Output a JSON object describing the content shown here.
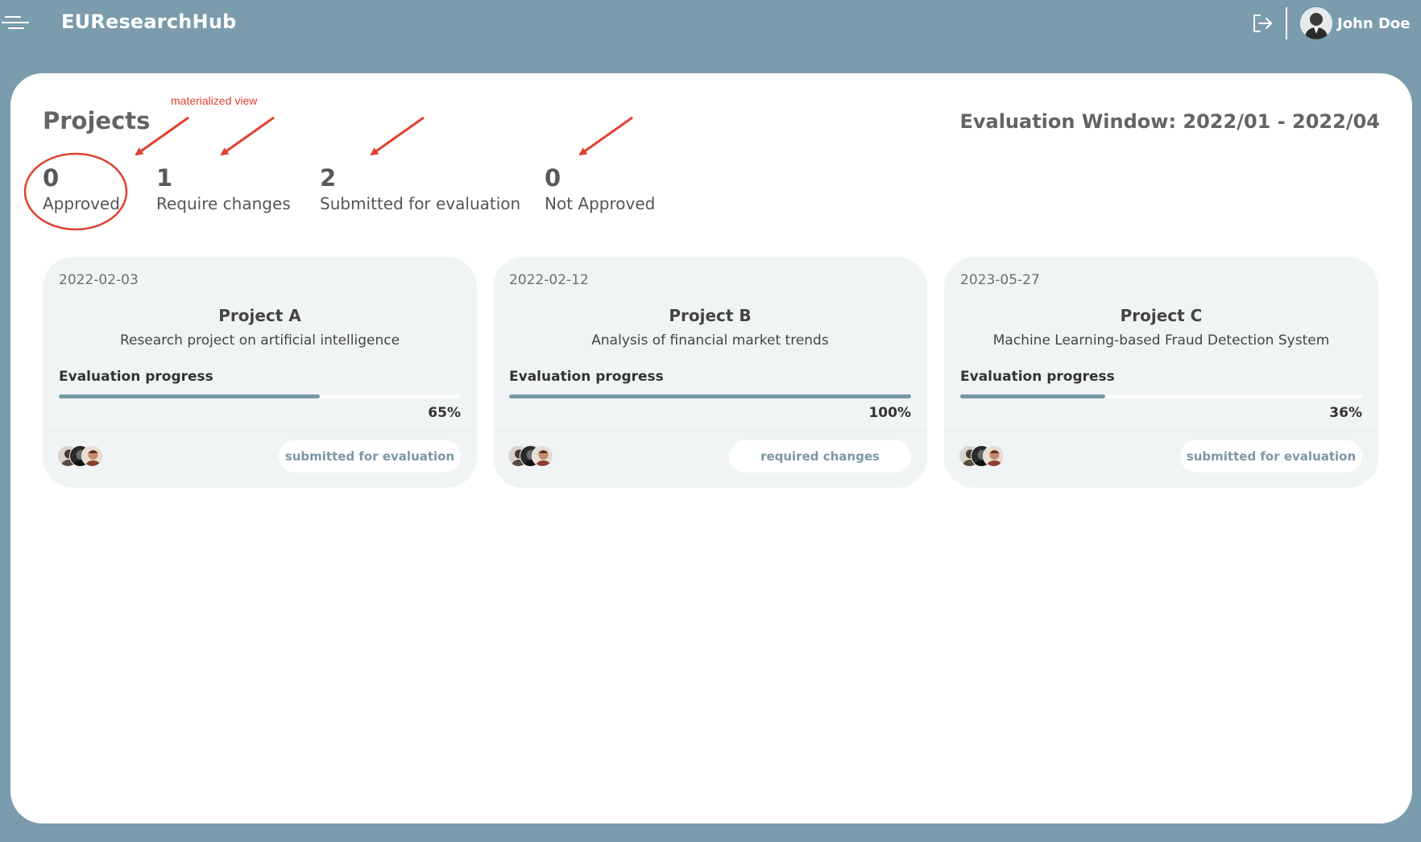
{
  "header": {
    "app_title": "EUResearchHub",
    "menu_icon": "hamburger-menu-icon",
    "logout_icon": "logout-icon",
    "user": {
      "name": "John Doe",
      "avatar_icon": "user-avatar"
    }
  },
  "page": {
    "title": "Projects",
    "evaluation_window": "Evaluation Window: 2022/01 - 2022/04"
  },
  "annotation": {
    "label": "materialized view",
    "color": "#e0402f"
  },
  "stats": [
    {
      "count": "0",
      "label": "Approved"
    },
    {
      "count": "1",
      "label": "Require changes"
    },
    {
      "count": "2",
      "label": "Submitted for evaluation"
    },
    {
      "count": "0",
      "label": "Not Approved"
    }
  ],
  "projects": [
    {
      "date": "2022-02-03",
      "title": "Project A",
      "description": "Research project on artificial intelligence",
      "progress_label": "Evaluation progress",
      "progress": 0.65,
      "progress_text": "65%",
      "status": "submitted for evaluation"
    },
    {
      "date": "2022-02-12",
      "title": "Project B",
      "description": "Analysis of financial market trends",
      "progress_label": "Evaluation progress",
      "progress": 1.0,
      "progress_text": "100%",
      "status": "required changes"
    },
    {
      "date": "2023-05-27",
      "title": "Project C",
      "description": "Machine Learning-based Fraud Detection System",
      "progress_label": "Evaluation progress",
      "progress": 0.36,
      "progress_text": "36%",
      "status": "submitted for evaluation"
    }
  ],
  "colors": {
    "background": "#7b9cac",
    "accent": "#7a98a8",
    "card_background": "#f1f4f5",
    "annotation": "#e0402f"
  }
}
